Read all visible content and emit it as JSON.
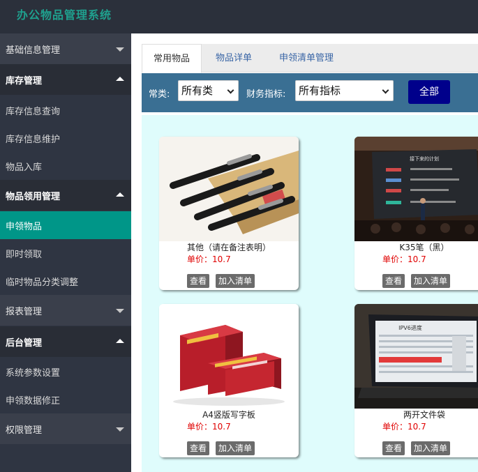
{
  "app": {
    "title": "办公物品管理系统"
  },
  "sidebar": {
    "items": [
      {
        "label": "基础信息管理"
      },
      {
        "label": "库存管理"
      },
      {
        "label": "库存信息查询"
      },
      {
        "label": "库存信息维护"
      },
      {
        "label": "物品入库"
      },
      {
        "label": "物品领用管理"
      },
      {
        "label": "申领物品"
      },
      {
        "label": "即时领取"
      },
      {
        "label": "临时物品分类调整"
      },
      {
        "label": "报表管理"
      },
      {
        "label": "后台管理"
      },
      {
        "label": "系统参数设置"
      },
      {
        "label": "申领数据修正"
      },
      {
        "label": "权限管理"
      }
    ]
  },
  "tabs": [
    {
      "label": "常用物品"
    },
    {
      "label": "物品详单"
    },
    {
      "label": "申领清单管理"
    }
  ],
  "filters": {
    "category_label": "常类:",
    "category_value": "所有类",
    "finance_label": "财务指标:",
    "finance_value": "所有指标",
    "all_button": "全部"
  },
  "products": [
    {
      "name": "其他（请在备注表明）",
      "price": "单价：10.7",
      "view": "查看",
      "add": "加入清单"
    },
    {
      "name": "K35笔（黑）",
      "price": "单价：10.7",
      "view": "查看",
      "add": "加入清单"
    },
    {
      "name": "A4竖版写字板",
      "price": "单价：10.7",
      "view": "查看",
      "add": "加入清单"
    },
    {
      "name": "两开文件袋",
      "price": "单价：10.7",
      "view": "查看",
      "add": "加入清单"
    }
  ],
  "images": {
    "slide_title": "接下来的计划",
    "laptop_title": "IPV6进度"
  },
  "colors": {
    "accent": "#009688",
    "title": "#1fa08e",
    "filter_bar": "#3a6f93",
    "all_button": "#00008b",
    "price": "#e00000"
  }
}
